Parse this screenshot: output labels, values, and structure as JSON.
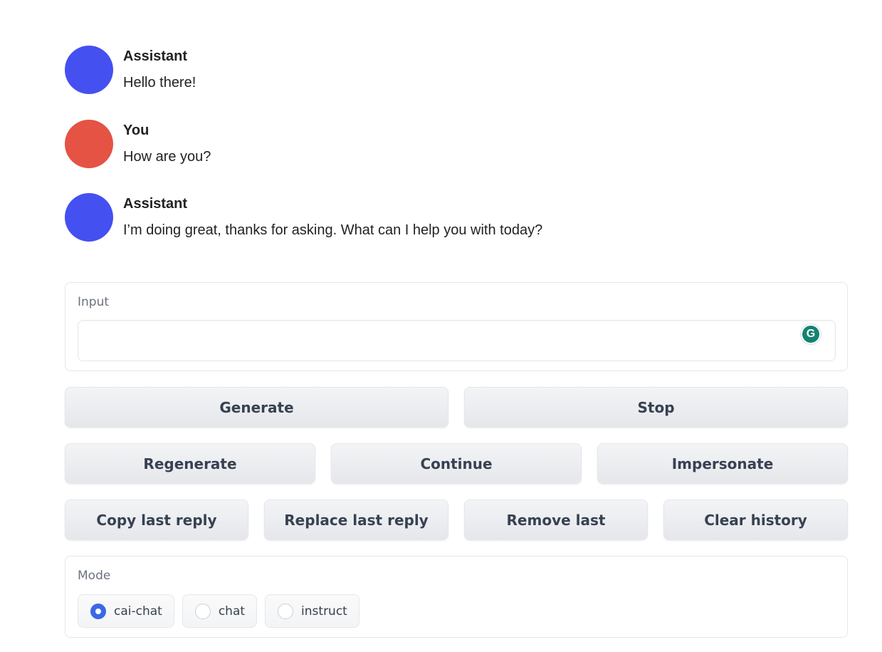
{
  "chat": {
    "messages": [
      {
        "name": "Assistant",
        "text": "Hello there!",
        "avatar_color": "#4450f0"
      },
      {
        "name": "You",
        "text": "How are you?",
        "avatar_color": "#e45343"
      },
      {
        "name": "Assistant",
        "text": "I’m doing great, thanks for asking. What can I help you with today?",
        "avatar_color": "#4450f0"
      }
    ]
  },
  "input": {
    "label": "Input",
    "value": "",
    "grammarly_icon": "G"
  },
  "buttons": {
    "generate": "Generate",
    "stop": "Stop",
    "regenerate": "Regenerate",
    "continue": "Continue",
    "impersonate": "Impersonate",
    "copy_last_reply": "Copy last reply",
    "replace_last_reply": "Replace last reply",
    "remove_last": "Remove last",
    "clear_history": "Clear history"
  },
  "mode": {
    "label": "Mode",
    "options": [
      "cai-chat",
      "chat",
      "instruct"
    ],
    "selected": "cai-chat",
    "accent_color": "#3b68e6"
  }
}
